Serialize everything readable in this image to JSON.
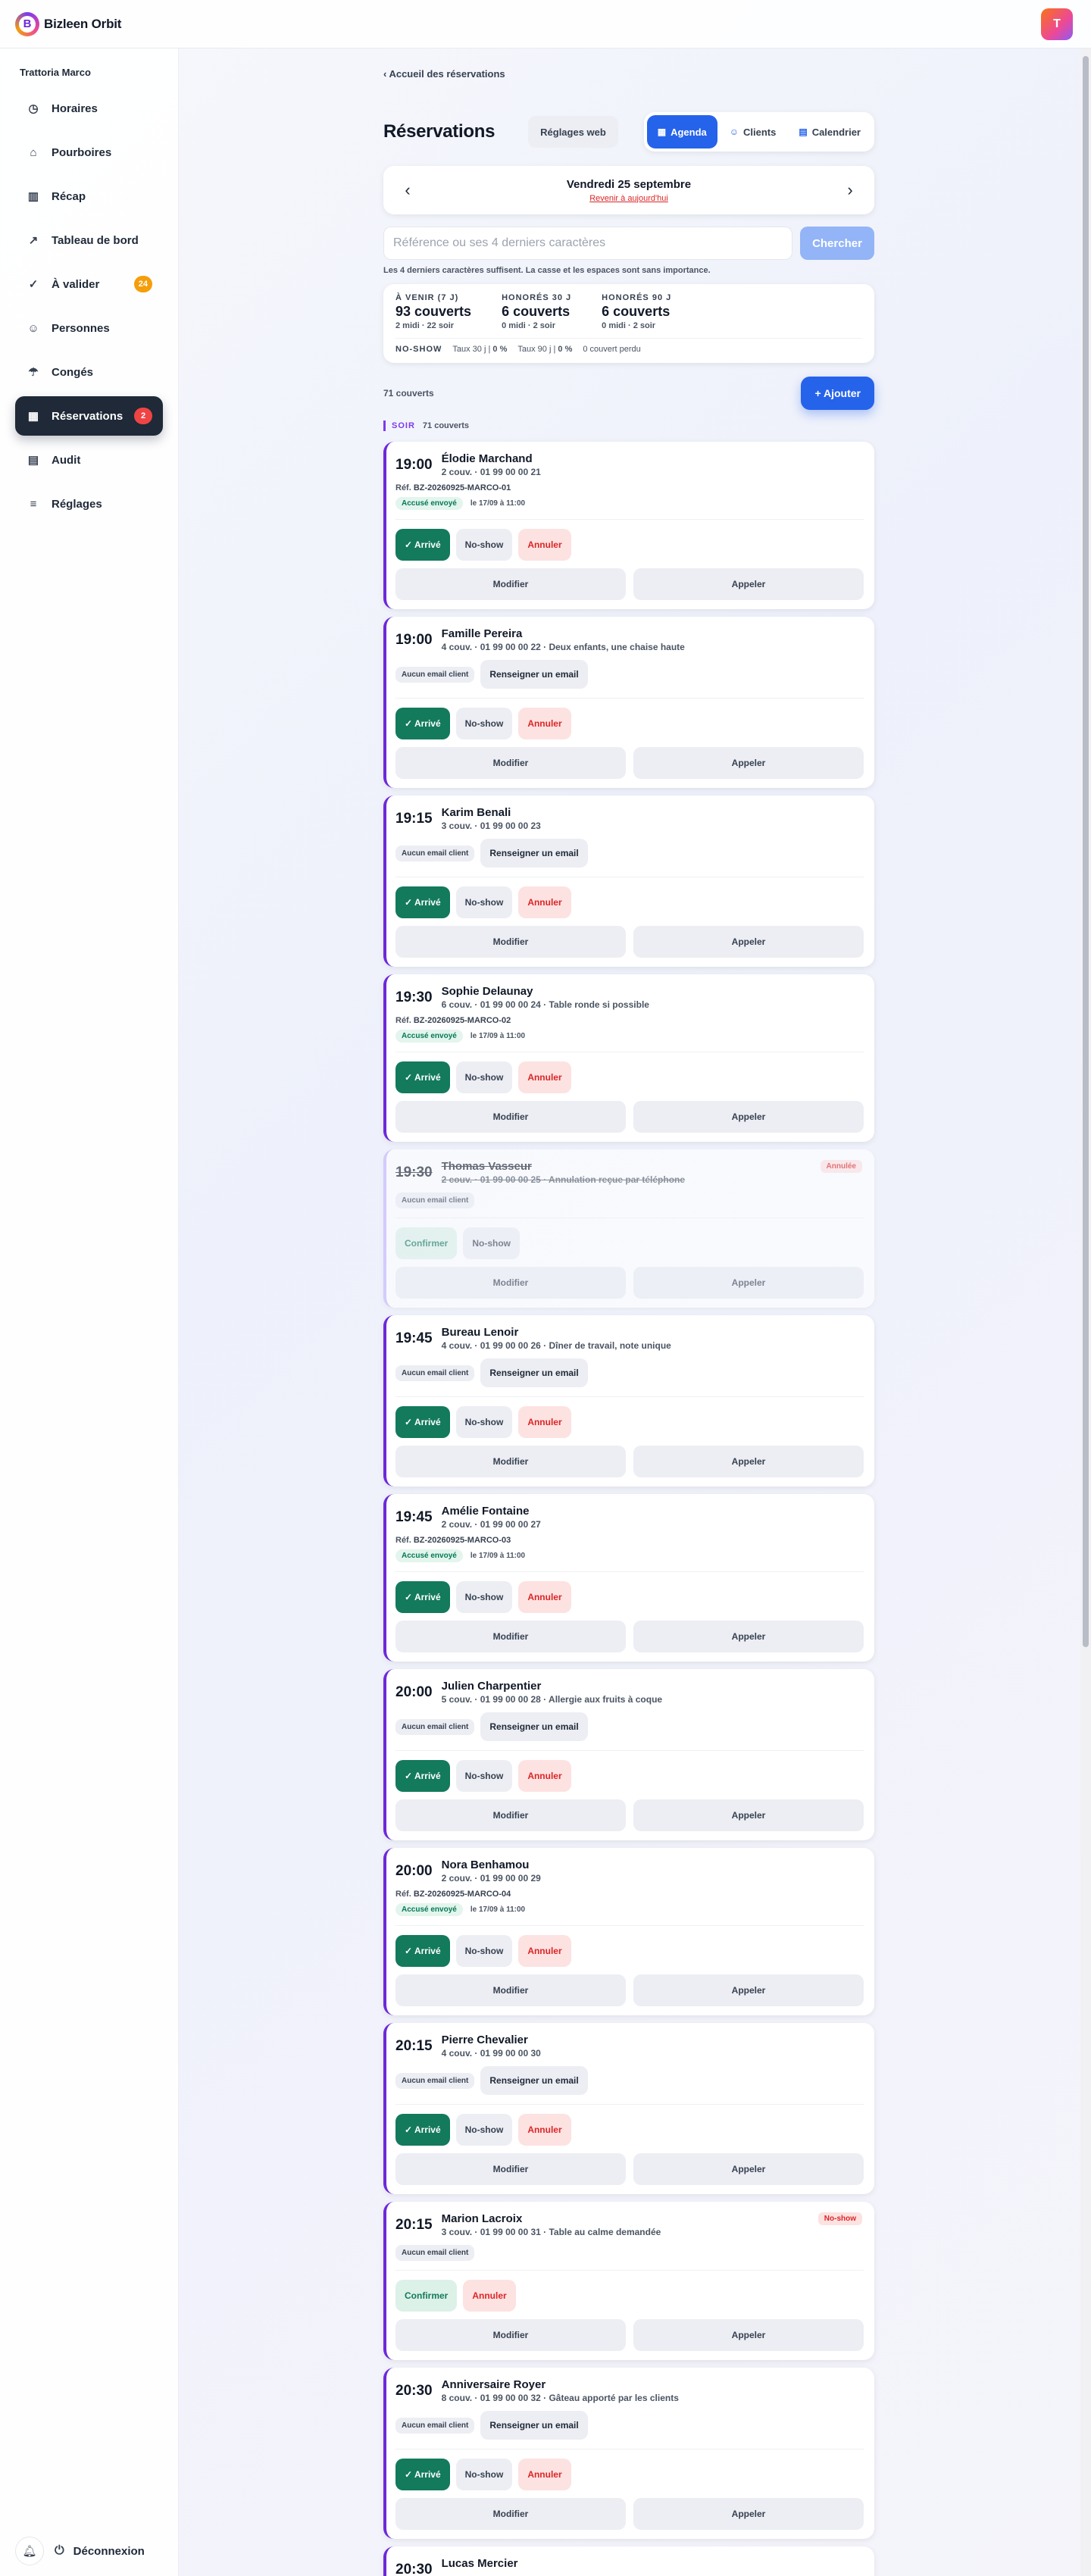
{
  "topbar": {
    "brand_name": "Bizleen Orbit",
    "logo_letter": "B",
    "avatar_letter": "T"
  },
  "sidebar": {
    "org_name": "Trattoria Marco",
    "items": [
      {
        "label": "Horaires",
        "icon": "clock-icon",
        "glyph": "◷"
      },
      {
        "label": "Pourboires",
        "icon": "tip-jar-icon",
        "glyph": "⌂"
      },
      {
        "label": "Récap",
        "icon": "bar-chart-icon",
        "glyph": "▥"
      },
      {
        "label": "Tableau de bord",
        "icon": "trend-icon",
        "glyph": "↗"
      },
      {
        "label": "À valider",
        "icon": "check-circle-icon",
        "glyph": "✓",
        "badge": "24"
      },
      {
        "label": "Personnes",
        "icon": "users-icon",
        "glyph": "☺"
      },
      {
        "label": "Congés",
        "icon": "umbrella-icon",
        "glyph": "☂"
      },
      {
        "label": "Réservations",
        "icon": "calendar-icon",
        "glyph": "▦",
        "badge": "2",
        "active": true
      },
      {
        "label": "Audit",
        "icon": "clipboard-icon",
        "glyph": "▤"
      },
      {
        "label": "Réglages",
        "icon": "sliders-icon",
        "glyph": "≡"
      }
    ],
    "logout_label": "Déconnexion"
  },
  "main": {
    "back_link": "‹ Accueil des réservations",
    "title": "Réservations",
    "web_settings": "Réglages web",
    "tabs": [
      {
        "label": "Agenda",
        "glyph": "▦"
      },
      {
        "label": "Clients",
        "glyph": "☺"
      },
      {
        "label": "Calendrier",
        "glyph": "▤"
      }
    ],
    "date": {
      "title": "Vendredi 25 septembre",
      "today_link": "Revenir à aujourd'hui",
      "prev": "‹",
      "next": "›"
    },
    "search": {
      "placeholder": "Référence ou ses 4 derniers caractères",
      "button": "Chercher",
      "hint": "Les 4 derniers caractères suffisent. La casse et les espaces sont sans importance."
    },
    "stats": [
      {
        "label": "À VENIR (7 J)",
        "value": "93 couverts",
        "sub": "2 midi · 22 soir"
      },
      {
        "label": "HONORÉS 30 J",
        "value": "6 couverts",
        "sub": "0 midi · 2 soir"
      },
      {
        "label": "HONORÉS 90 J",
        "value": "6 couverts",
        "sub": "0 midi · 2 soir"
      }
    ],
    "noshow": {
      "label": "NO-SHOW",
      "rate30_label": "Taux 30 j",
      "rate30_value": "0 %",
      "rate90_label": "Taux 90 j",
      "rate90_value": "0 %",
      "lost": "0 couvert perdu"
    },
    "count_text": "71 couverts",
    "add_button": "+ Ajouter",
    "section": {
      "name": "SOIR",
      "count": "71 couverts"
    }
  },
  "labels": {
    "arrive": "✓ Arrivé",
    "noshow": "No-show",
    "annuler": "Annuler",
    "confirmer": "Confirmer",
    "modifier": "Modifier",
    "appeler": "Appeler",
    "no_email": "Aucun email client",
    "fill_email": "Renseigner un email",
    "ref_prefix": "Réf.",
    "ack": "Accusé envoyé"
  },
  "reservations": [
    {
      "time": "19:00",
      "name": "Élodie Marchand",
      "detail": "2 couv. · 01 99 00 00 21",
      "ref": "BZ-20260925-MARCO-01",
      "ack_date": "le 17/09 à 11:00",
      "state": "active"
    },
    {
      "time": "19:00",
      "name": "Famille Pereira",
      "detail": "4 couv. · 01 99 00 00 22 · Deux enfants, une chaise haute",
      "state": "active"
    },
    {
      "time": "19:15",
      "name": "Karim Benali",
      "detail": "3 couv. · 01 99 00 00 23",
      "state": "active"
    },
    {
      "time": "19:30",
      "name": "Sophie Delaunay",
      "detail": "6 couv. · 01 99 00 00 24 · Table ronde si possible",
      "ref": "BZ-20260925-MARCO-02",
      "ack_date": "le 17/09 à 11:00",
      "state": "active"
    },
    {
      "time": "19:30",
      "name": "Thomas Vasseur",
      "detail": "2 couv. · 01 99 00 00 25 · Annulation reçue par téléphone",
      "status": "Annulée",
      "state": "cancelled"
    },
    {
      "time": "19:45",
      "name": "Bureau Lenoir",
      "detail": "4 couv. · 01 99 00 00 26 · Dîner de travail, note unique",
      "state": "active"
    },
    {
      "time": "19:45",
      "name": "Amélie Fontaine",
      "detail": "2 couv. · 01 99 00 00 27",
      "ref": "BZ-20260925-MARCO-03",
      "ack_date": "le 17/09 à 11:00",
      "state": "active"
    },
    {
      "time": "20:00",
      "name": "Julien Charpentier",
      "detail": "5 couv. · 01 99 00 00 28 · Allergie aux fruits à coque",
      "state": "active"
    },
    {
      "time": "20:00",
      "name": "Nora Benhamou",
      "detail": "2 couv. · 01 99 00 00 29",
      "ref": "BZ-20260925-MARCO-04",
      "ack_date": "le 17/09 à 11:00",
      "state": "active"
    },
    {
      "time": "20:15",
      "name": "Pierre Chevalier",
      "detail": "4 couv. · 01 99 00 00 30",
      "state": "active"
    },
    {
      "time": "20:15",
      "name": "Marion Lacroix",
      "detail": "3 couv. · 01 99 00 00 31 · Table au calme demandée",
      "status": "No-show",
      "state": "noshow"
    },
    {
      "time": "20:30",
      "name": "Anniversaire Royer",
      "detail": "8 couv. · 01 99 00 00 32 · Gâteau apporté par les clients",
      "state": "active"
    },
    {
      "time": "20:30",
      "name": "Lucas Mercier",
      "detail": "",
      "state": "active"
    }
  ]
}
